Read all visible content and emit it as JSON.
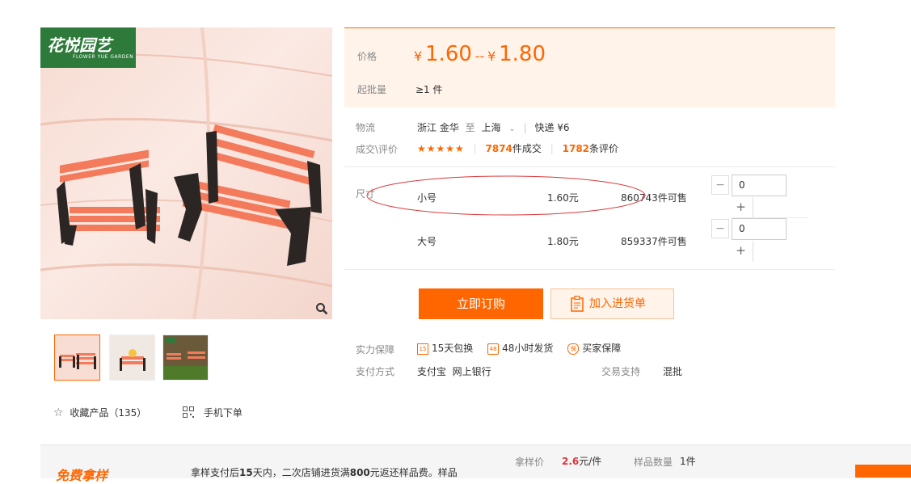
{
  "gallery": {
    "logo_text": "花悦园艺",
    "logo_subtext": "FLOWER YUE GARDEN",
    "fav_label": "收藏产品",
    "fav_count": "（135）",
    "mobile_label": "手机下单"
  },
  "price": {
    "label": "价格",
    "currency": "¥",
    "low": "1.60",
    "range_sep": "--",
    "high": "1.80",
    "moq_label": "起批量",
    "moq_value": "≥1 件"
  },
  "logistics": {
    "label": "物流",
    "from": "浙江 金华",
    "to_word": "至",
    "to": "上海",
    "express": "快递 ¥6"
  },
  "deals": {
    "label": "成交\\评价",
    "stars": "★★★★★",
    "deals_count": "7874",
    "deals_suffix": "件成交",
    "reviews_count": "1782",
    "reviews_suffix": "条评价"
  },
  "sku": {
    "label": "尺寸",
    "items": [
      {
        "name": "小号",
        "price": "1.60元",
        "stock": "860743件可售",
        "qty": "0",
        "minus": "−",
        "plus": "+"
      },
      {
        "name": "大号",
        "price": "1.80元",
        "stock": "859337件可售",
        "qty": "0",
        "minus": "−",
        "plus": "+"
      }
    ]
  },
  "actions": {
    "buy_now": "立即订购",
    "add_cart": "加入进货单"
  },
  "guarantee": {
    "label": "实力保障",
    "items": [
      "15天包换",
      "48小时发货",
      "买家保障"
    ],
    "icon_texts": [
      "15",
      "48",
      "保"
    ]
  },
  "payment": {
    "label": "支付方式",
    "methods": "支付宝  网上银行",
    "trade_label": "交易支持",
    "trade_value": "混批"
  },
  "sample": {
    "title": "免费拿样",
    "desc_pre": "拿样支付后",
    "desc_days": "15",
    "desc_mid": "天内，二次店铺进货满",
    "desc_amount": "800",
    "desc_post": "元返还样品费。样品",
    "price_label": "拿样价",
    "price_value": "2.6",
    "price_unit": "元/件",
    "qty_label": "样品数量",
    "qty_value": "1件"
  },
  "colors": {
    "accent": "#ff6600",
    "price_bg": "#fff3ea",
    "logo_green": "#2e7a3a",
    "highlight_oval": "#d9383a"
  },
  "icons": [
    "zoom-icon",
    "star-outline-icon",
    "qrcode-icon",
    "chevron-down-icon",
    "cart-list-icon",
    "guarantee-icon"
  ]
}
